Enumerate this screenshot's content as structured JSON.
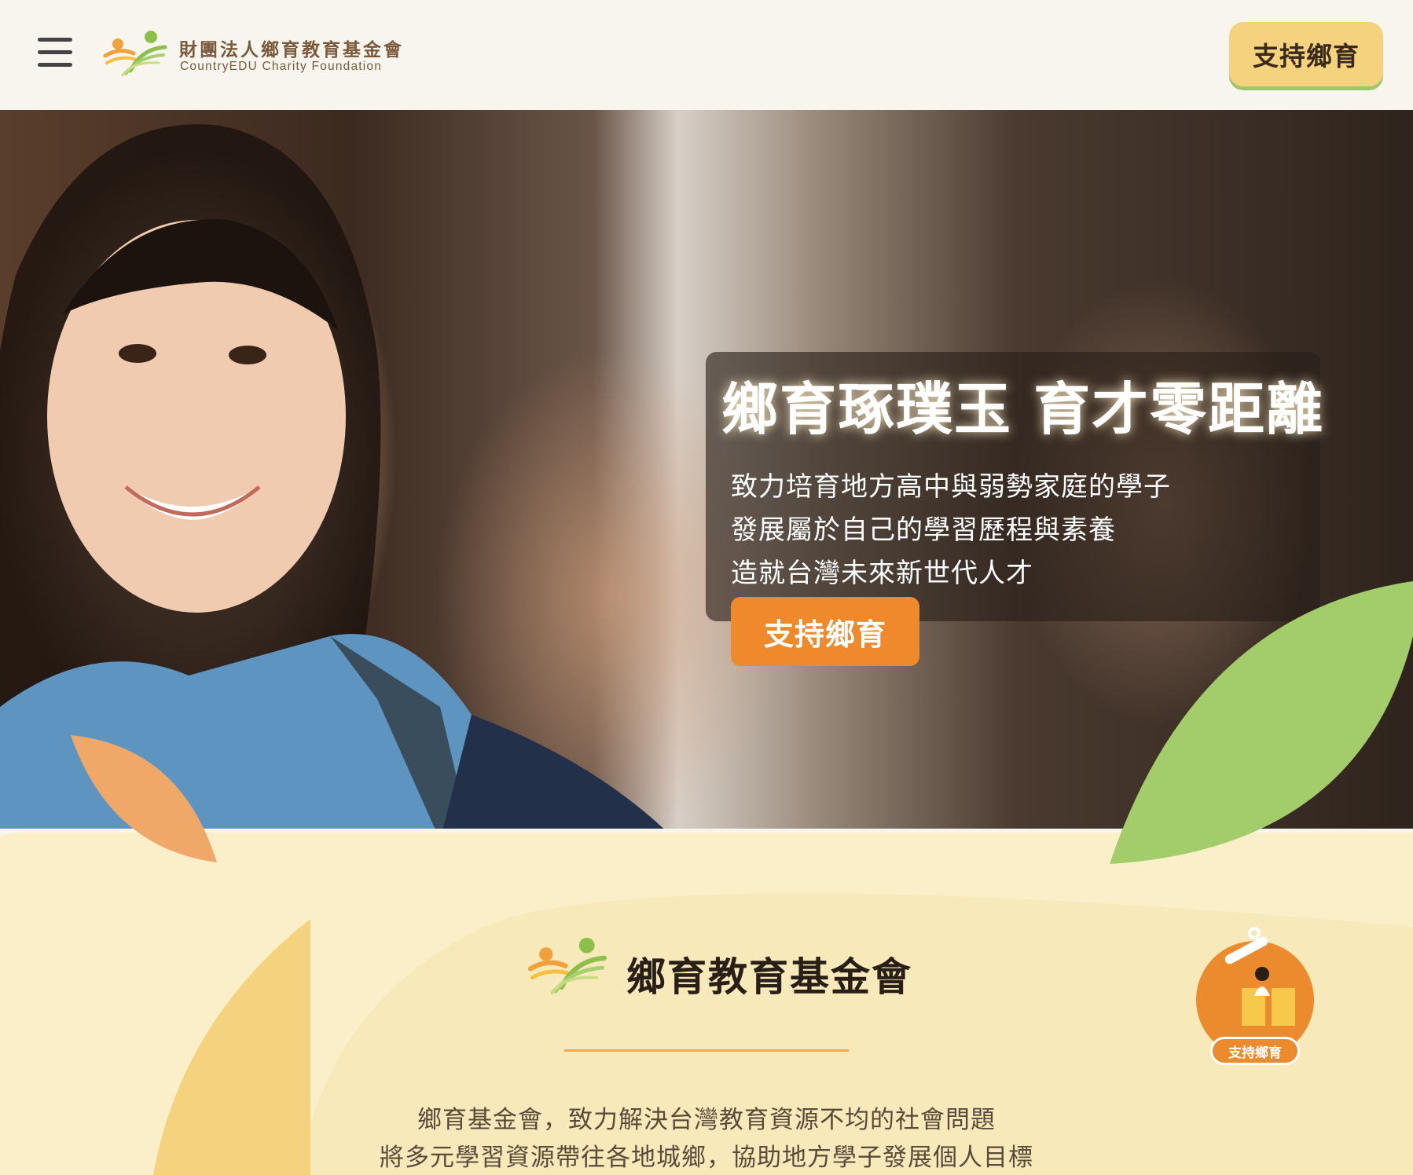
{
  "header": {
    "logo_zh": "財團法人鄉育教育基金會",
    "logo_en": "CountryEDU Charity Foundation",
    "support_label": "支持鄉育"
  },
  "hero": {
    "title": "鄉育琢璞玉 育才零距離",
    "lines": [
      "致力培育地方高中與弱勢家庭的學子",
      "發展屬於自己的學習歷程與素養",
      "造就台灣未來新世代人才"
    ],
    "cta_label": "支持鄉育"
  },
  "about": {
    "title": "鄉育教育基金會",
    "lines": [
      "鄉育基金會，致力解決台灣教育資源不均的社會問題",
      "將多元學習資源帶往各地城鄉，協助地方學子發展個人目標"
    ]
  },
  "floating": {
    "support_label": "支持鄉育"
  },
  "colors": {
    "background": "#f8f4ee",
    "cream": "#faefc8",
    "accent_orange": "#ee8a2c",
    "accent_yellow": "#f5d27e",
    "accent_green": "#9dc86a"
  }
}
